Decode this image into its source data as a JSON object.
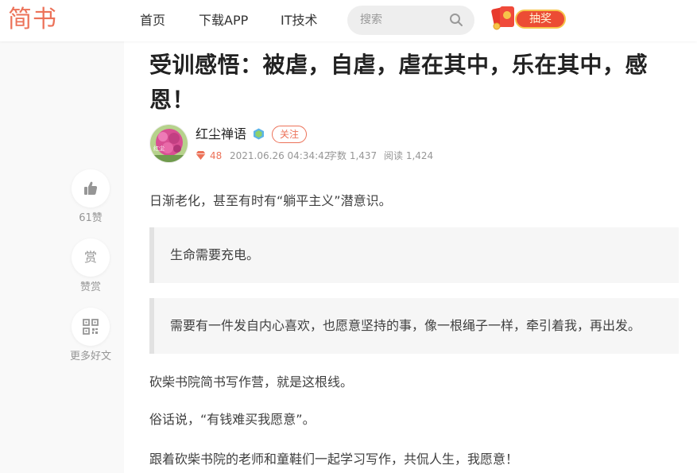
{
  "header": {
    "logo": "简书",
    "nav": [
      "首页",
      "下载APP",
      "IT技术"
    ],
    "search_placeholder": "搜索",
    "lottery_label": "抽奖"
  },
  "article": {
    "title": "受训感悟：被虐，自虐，虐在其中，乐在其中，感恩！",
    "author": "红尘禅语",
    "follow_label": "关注",
    "diamond": "48",
    "date": "2021.06.26 04:34:42",
    "words": "字数 1,437",
    "reads": "阅读 1,424",
    "p1": "日渐老化，甚至有时有“躺平主义”潜意识。",
    "quote1": "生命需要充电。",
    "quote2": "需要有一件发自内心喜欢，也愿意坚持的事，像一根绳子一样，牵引着我，再出发。",
    "p2": "砍柴书院简书写作营，就是这根线。",
    "p3": "俗话说，“有钱难买我愿意”。",
    "p4": "跟着砍柴书院的老师和童鞋们一起学习写作，共侃人生，我愿意！"
  },
  "side": {
    "like_label": "61赞",
    "reward_icon_text": "赏",
    "reward_label": "赞赏",
    "more_label": "更多好文"
  },
  "colors": {
    "brand": "#ec7259",
    "lottery_bg": "#ec4c34"
  },
  "icons": [
    "search-icon",
    "red-packet-icon",
    "author-badge-icon",
    "diamond-icon",
    "thumbs-up-icon",
    "qr-code-icon"
  ]
}
